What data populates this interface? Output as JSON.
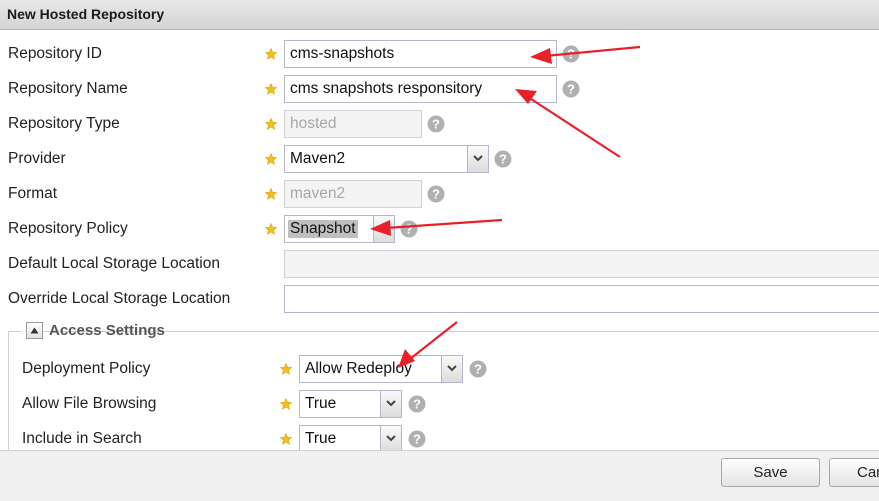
{
  "window": {
    "title": "New Hosted Repository"
  },
  "fields": {
    "repository_id": {
      "label": "Repository ID",
      "value": "cms-snapshots"
    },
    "repository_name": {
      "label": "Repository Name",
      "value": "cms snapshots responsitory"
    },
    "repository_type": {
      "label": "Repository Type",
      "value": "hosted"
    },
    "provider": {
      "label": "Provider",
      "value": "Maven2"
    },
    "format": {
      "label": "Format",
      "value": "maven2"
    },
    "repository_policy": {
      "label": "Repository Policy",
      "value": "Snapshot"
    },
    "default_storage": {
      "label": "Default Local Storage Location",
      "value": ""
    },
    "override_storage": {
      "label": "Override Local Storage Location",
      "value": ""
    }
  },
  "access_settings": {
    "title": "Access Settings",
    "deployment_policy": {
      "label": "Deployment Policy",
      "value": "Allow Redeploy"
    },
    "allow_file_browsing": {
      "label": "Allow File Browsing",
      "value": "True"
    },
    "include_in_search": {
      "label": "Include in Search",
      "value": "True"
    }
  },
  "buttons": {
    "save": "Save",
    "cancel": "Can"
  },
  "colors": {
    "annotation_arrow": "#e8202a",
    "required_star": "#f0c020",
    "help_icon": "#b0b0b0"
  },
  "icons": [
    "required-star-icon",
    "help-icon",
    "chevron-down-icon",
    "collapse-icon"
  ]
}
